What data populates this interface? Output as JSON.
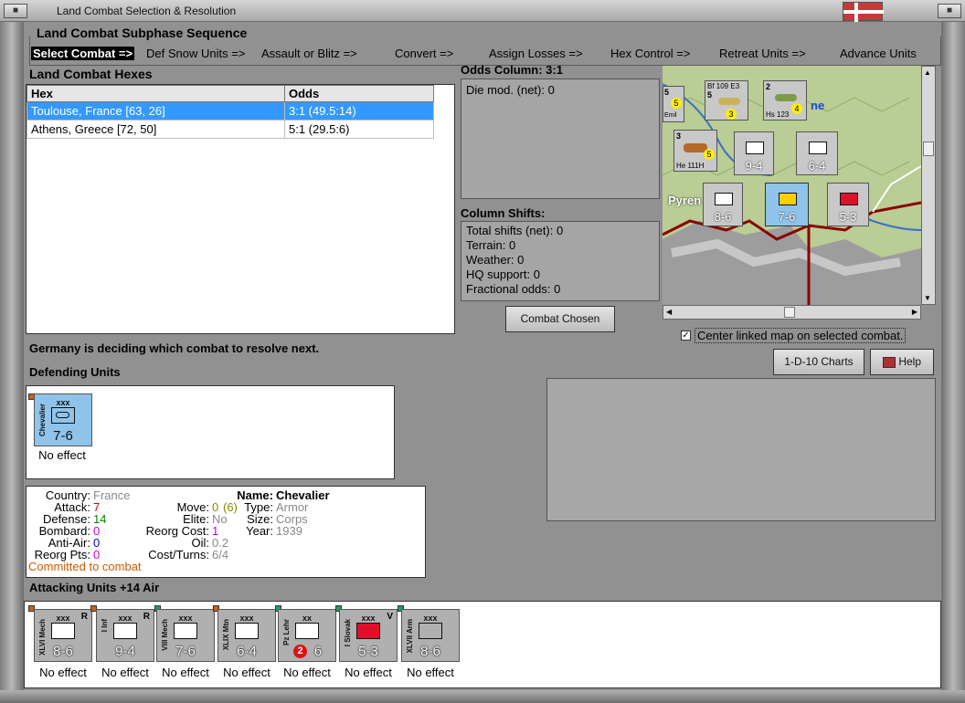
{
  "window": {
    "title": "Land Combat Selection & Resolution"
  },
  "subphase": {
    "title": "Land Combat Subphase Sequence",
    "steps": [
      "Select Combat =>",
      "Def Snow Units =>",
      "Assault or Blitz =>",
      "Convert =>",
      "Assign Losses =>",
      "Hex Control =>",
      "Retreat Units =>",
      "Advance Units"
    ]
  },
  "hexes": {
    "title": "Land Combat Hexes",
    "columns": [
      "Hex",
      "Odds"
    ],
    "rows": [
      {
        "hex": "Toulouse, France [63, 26]",
        "odds": "3:1 (49.5:14)"
      },
      {
        "hex": "Athens, Greece [72, 50]",
        "odds": "5:1 (29.5:6)"
      }
    ]
  },
  "odds": {
    "title": "Odds Column: 3:1",
    "die_mod": "Die mod. (net): 0"
  },
  "shifts": {
    "title": "Column Shifts:",
    "lines": [
      "Total shifts (net): 0",
      "Terrain: 0",
      "Weather: 0",
      "HQ support: 0",
      "Fractional odds: 0"
    ]
  },
  "combat_chosen_label": "Combat Chosen",
  "center_map_label": "Center linked map on selected combat.",
  "charts_label": "1-D-10 Charts",
  "help_label": "Help",
  "status": "Germany is deciding which combat to resolve next.",
  "defending": {
    "title": "Defending Units",
    "units": [
      {
        "size": "xxx",
        "name": "Chevalier",
        "strength": "7-6",
        "result": "No effect"
      }
    ]
  },
  "unit_info": {
    "country_k": "Country:",
    "country": "France",
    "attack_k": "Attack:",
    "attack": "7",
    "defense_k": "Defense:",
    "defense": "14",
    "bombard_k": "Bombard:",
    "bombard": "0",
    "antiair_k": "Anti-Air:",
    "antiair": "0",
    "reorgpts_k": "Reorg Pts:",
    "reorgpts": "0",
    "move_k": "Move:",
    "move": "0",
    "move_extra": "(6)",
    "elite_k": "Elite:",
    "elite": "No",
    "reorgcost_k": "Reorg Cost:",
    "reorgcost": "1",
    "oil_k": "Oil:",
    "oil": "0.2",
    "costturns_k": "Cost/Turns:",
    "costturns": "6/4",
    "name_k": "Name:",
    "name": "Chevalier",
    "type_k": "Type:",
    "type": "Armor",
    "size_k": "Size:",
    "size": "Corps",
    "year_k": "Year:",
    "year": "1939",
    "committed": "Committed to combat"
  },
  "attacking": {
    "title": "Attacking Units +14 Air",
    "units": [
      {
        "size": "xxx",
        "name": "XLVI Mech",
        "corner": "R",
        "strength": "8-6",
        "result": "No effect",
        "color": "#b0b0b0"
      },
      {
        "size": "xxx",
        "name": "I Inf",
        "corner": "R",
        "strength": "9-4",
        "result": "No effect",
        "color": "#b0b0b0"
      },
      {
        "size": "xxx",
        "name": "VIII Mech",
        "corner": "",
        "strength": "7-6",
        "result": "No effect",
        "color": "#b0b0b0"
      },
      {
        "size": "xxx",
        "name": "XLIX Mtn",
        "corner": "",
        "strength": "6-4",
        "result": "No effect",
        "color": "#b0b0b0"
      },
      {
        "size": "xx",
        "name": "Pz Lehr",
        "corner": "",
        "strength": "6",
        "badge": "2",
        "result": "No effect",
        "color": "#b0b0b0"
      },
      {
        "size": "xxx",
        "name": "I Slovak",
        "corner": "V",
        "strength": "5-3",
        "result": "No effect",
        "color": "#b0b0b0"
      },
      {
        "size": "xxx",
        "name": "XLVII Arm",
        "corner": "",
        "strength": "8-6",
        "result": "No effect",
        "color": "#b0b0b0"
      }
    ]
  },
  "map": {
    "labels": [
      "Pyren",
      "ne"
    ],
    "counters": [
      {
        "strength": "8-6"
      },
      {
        "strength": "7-6"
      },
      {
        "strength": "5-3"
      },
      {
        "strength": "9-4"
      },
      {
        "strength": "6-4"
      }
    ],
    "air": [
      {
        "name": "Bf 109 E3",
        "n": "5",
        "badge": "3"
      },
      {
        "name": "Hs 123",
        "n": "2",
        "badge": "4"
      },
      {
        "name": "He 111H",
        "n": "3",
        "badge": "5"
      },
      {
        "name": "Emil",
        "n": "5",
        "badge": "5"
      }
    ]
  },
  "colors": {
    "selected_row": "#3399ff",
    "committed": "#c85a00",
    "attack": "#cc0000",
    "defense": "#008800",
    "bombard": "#cc00cc",
    "antiair": "#0000cc"
  }
}
